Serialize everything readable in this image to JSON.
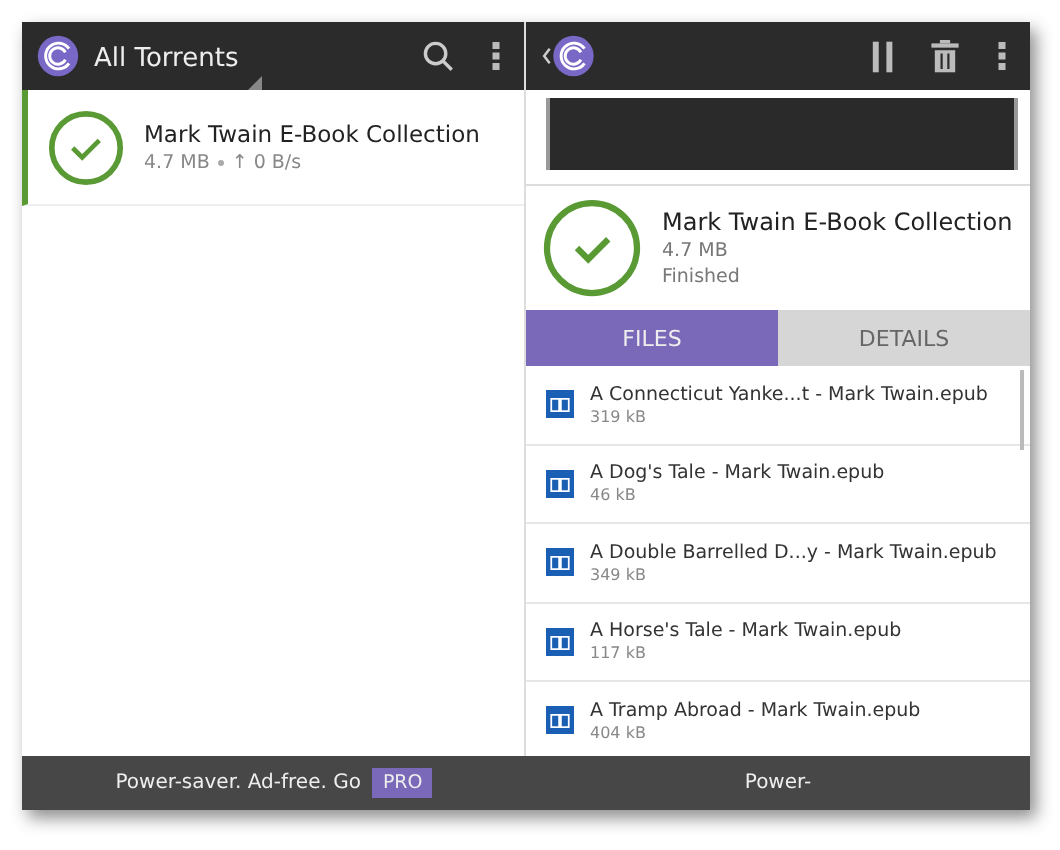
{
  "left_bar": {
    "title": "All Torrents"
  },
  "torrents": [
    {
      "name": "Mark Twain E-Book Collection",
      "size": "4.7 MB",
      "speed": "↑ 0 B/s",
      "selected": true
    }
  ],
  "detail": {
    "name": "Mark Twain E-Book Collection",
    "size": "4.7 MB",
    "status": "Finished"
  },
  "tabs": [
    {
      "label": "FILES",
      "selected": true
    },
    {
      "label": "DETAILS",
      "selected": false
    }
  ],
  "files": [
    {
      "name": "A Connecticut Yanke...t - Mark Twain.epub",
      "size": "319 kB"
    },
    {
      "name": "A Dog's Tale - Mark Twain.epub",
      "size": "46 kB"
    },
    {
      "name": "A Double Barrelled D...y - Mark Twain.epub",
      "size": "349 kB"
    },
    {
      "name": "A Horse's Tale - Mark Twain.epub",
      "size": "117 kB"
    },
    {
      "name": "A Tramp Abroad - Mark Twain.epub",
      "size": "404 kB"
    }
  ],
  "footer": {
    "left": "Power-saver. Ad-free. Go",
    "badge": "PRO",
    "right": "Power-"
  }
}
